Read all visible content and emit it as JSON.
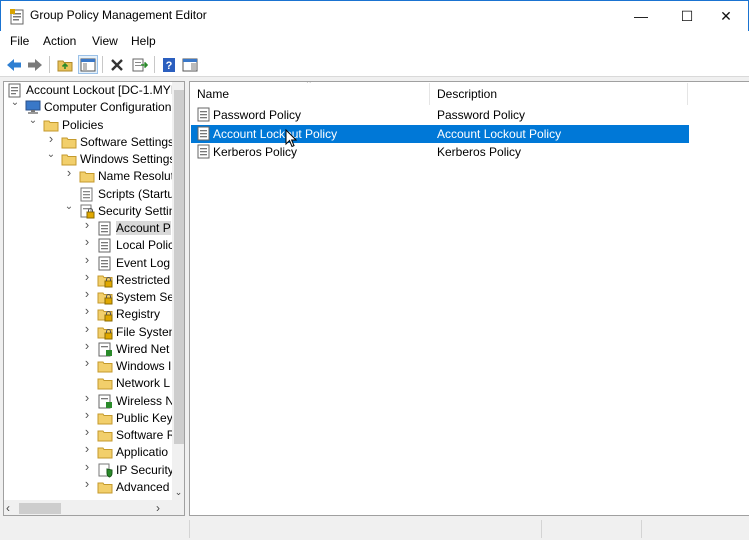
{
  "window": {
    "title": "Group Policy Management Editor",
    "buttons": {
      "minimize": "—",
      "maximize": "☐",
      "close": "✕"
    }
  },
  "menu": [
    "File",
    "Action",
    "View",
    "Help"
  ],
  "toolbar": {
    "icons": [
      "back-arrow-icon",
      "forward-arrow-icon",
      "up-folder-icon",
      "show-hide-tree-icon",
      "delete-icon",
      "export-list-icon",
      "help-icon",
      "properties-pane-icon"
    ]
  },
  "tree": {
    "root": "Account Lockout [DC-1.MYI",
    "computer_configuration": "Computer Configuration",
    "policies": "Policies",
    "software_settings": "Software Settings",
    "windows_settings": "Windows Settings",
    "name_resolution": "Name Resolut",
    "scripts": "Scripts (Startu",
    "security_settings": "Security Settin",
    "children": [
      "Account P",
      "Local Polic",
      "Event Log",
      "Restricted",
      "System Se",
      "Registry",
      "File Systen",
      "Wired Net",
      "Windows I",
      "Network L",
      "Wireless N",
      "Public Key",
      "Software R",
      "Applicatio",
      "IP Security",
      "Advanced"
    ]
  },
  "list": {
    "headers": {
      "name": "Name",
      "description": "Description"
    },
    "rows": [
      {
        "name": "Password Policy",
        "description": "Password Policy"
      },
      {
        "name": "Account Lockout Policy",
        "description": "Account Lockout Policy",
        "selected": true
      },
      {
        "name": "Kerberos Policy",
        "description": "Kerberos Policy"
      }
    ]
  },
  "colors": {
    "selection": "#0078d7",
    "window_border": "#1a73d1"
  }
}
